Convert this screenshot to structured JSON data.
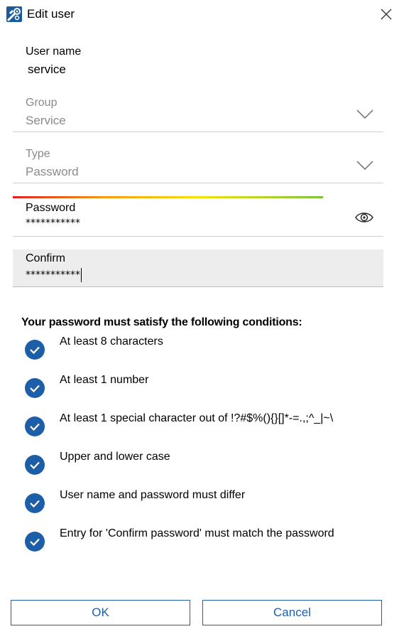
{
  "window": {
    "title": "Edit user",
    "app_icon": "wrench-gear-icon",
    "accent_color": "#1d5ea8"
  },
  "username": {
    "label": "User name",
    "value": "service"
  },
  "group": {
    "label": "Group",
    "value": "Service",
    "icon": "chevron-down-icon"
  },
  "type": {
    "label": "Type",
    "value": "Password",
    "icon": "chevron-down-icon"
  },
  "password": {
    "label": "Password",
    "value": "***********",
    "strength": 0.81,
    "icon": "eye-icon"
  },
  "confirm": {
    "label": "Confirm",
    "value": "***********"
  },
  "conditions": {
    "title": "Your password must satisfy the following conditions:",
    "items": [
      {
        "text": "At least 8 characters",
        "satisfied": true
      },
      {
        "text": "At least 1 number",
        "satisfied": true
      },
      {
        "text": "At least 1 special character out of !?#$%(){}[]*-=.,;^_|~\\",
        "satisfied": true
      },
      {
        "text": "Upper and lower case",
        "satisfied": true
      },
      {
        "text": "User name and password must differ",
        "satisfied": true
      },
      {
        "text": "Entry for 'Confirm password' must match the password",
        "satisfied": true
      }
    ]
  },
  "buttons": {
    "ok": "OK",
    "cancel": "Cancel"
  }
}
